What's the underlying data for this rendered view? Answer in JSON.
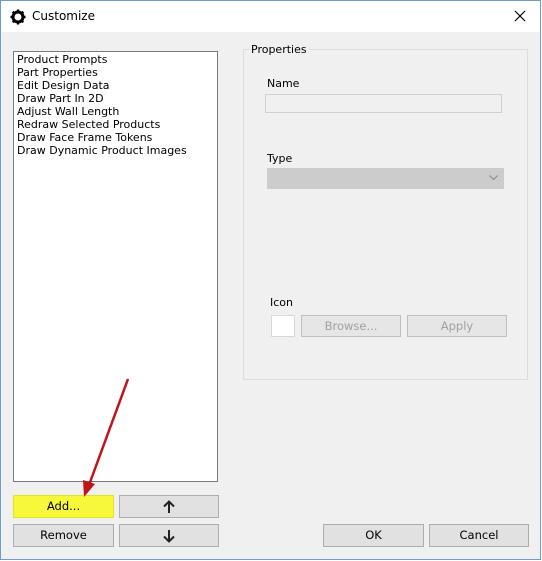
{
  "window": {
    "title": "Customize",
    "close_glyph": "×"
  },
  "commands_list": [
    "Product Prompts",
    "Part Properties",
    "Edit Design Data",
    "Draw Part In 2D",
    "Adjust Wall Length",
    "Redraw Selected Products",
    "Draw Face Frame Tokens",
    "Draw Dynamic Product Images"
  ],
  "properties": {
    "group_label": "Properties",
    "name_label": "Name",
    "name_value": "",
    "type_label": "Type",
    "type_value": "",
    "icon_label": "Icon",
    "browse_label": "Browse...",
    "apply_label": "Apply"
  },
  "buttons": {
    "add": "Add...",
    "remove": "Remove",
    "ok": "OK",
    "cancel": "Cancel",
    "move_up_icon": "arrow-up-icon",
    "move_down_icon": "arrow-down-icon"
  },
  "colors": {
    "highlight": "#f8f83a",
    "annotation_arrow": "#c0141c"
  }
}
